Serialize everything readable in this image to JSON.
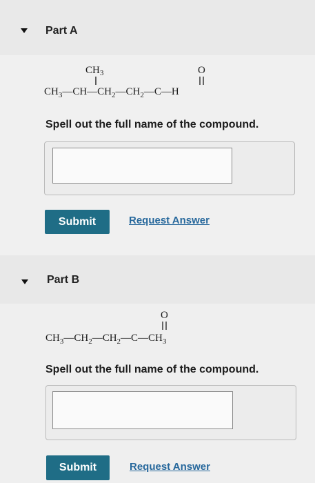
{
  "part_a": {
    "title": "Part A",
    "structure": {
      "branch": "CH",
      "branch_sub": "3",
      "oxygen": "O",
      "chain": [
        {
          "t": "CH"
        },
        {
          "t": "3",
          "sub": true
        },
        {
          "t": "—CH—CH"
        },
        {
          "t": "2",
          "sub": true
        },
        {
          "t": "—CH"
        },
        {
          "t": "2",
          "sub": true
        },
        {
          "t": "—C—H"
        }
      ]
    },
    "prompt": "Spell out the full name of the compound.",
    "answer_value": "",
    "submit_label": "Submit",
    "request_label": "Request Answer"
  },
  "part_b": {
    "title": "Part B",
    "structure": {
      "oxygen": "O",
      "chain": [
        {
          "t": "CH"
        },
        {
          "t": "3",
          "sub": true
        },
        {
          "t": "—CH"
        },
        {
          "t": "2",
          "sub": true
        },
        {
          "t": "—CH"
        },
        {
          "t": "2",
          "sub": true
        },
        {
          "t": "—C—CH"
        },
        {
          "t": "3",
          "sub": true
        }
      ]
    },
    "prompt": "Spell out the full name of the compound.",
    "answer_value": "",
    "submit_label": "Submit",
    "request_label": "Request Answer"
  }
}
